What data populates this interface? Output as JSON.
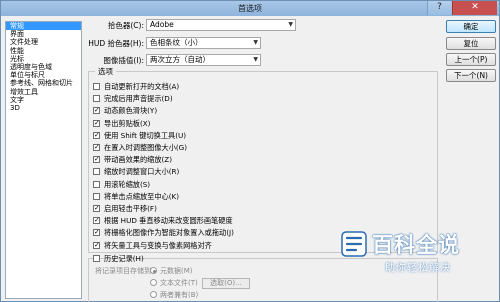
{
  "window": {
    "title": "首选项",
    "help_label": "?",
    "close_label": "✕"
  },
  "sidebar": {
    "items": [
      {
        "label": "常规",
        "selected": true
      },
      {
        "label": "界面"
      },
      {
        "label": "文件处理"
      },
      {
        "label": "性能"
      },
      {
        "label": "光标"
      },
      {
        "label": "透明度与色域"
      },
      {
        "label": "单位与标尺"
      },
      {
        "label": "参考线、网格和切片"
      },
      {
        "label": "增效工具"
      },
      {
        "label": "文字"
      },
      {
        "label": "3D"
      }
    ]
  },
  "settings": {
    "color_picker_label": "拾色器(C):",
    "color_picker_value": "Adobe",
    "hud_picker_label": "HUD 拾色器(H):",
    "hud_picker_value": "色相条纹（小）",
    "interp_label": "图像插值(I):",
    "interp_value": "两次立方（自动）"
  },
  "buttons": {
    "ok": "确定",
    "reset": "复位",
    "prev": "上一个(P)",
    "next": "下一个(N)"
  },
  "options": {
    "title": "选项",
    "items": [
      {
        "label": "自动更新打开的文档(A)",
        "checked": false
      },
      {
        "label": "完成后用声音提示(D)",
        "checked": false
      },
      {
        "label": "动态颜色滑块(Y)",
        "checked": true
      },
      {
        "label": "导出剪贴板(X)",
        "checked": true
      },
      {
        "label": "使用 Shift 键切换工具(U)",
        "checked": true
      },
      {
        "label": "在置入时调整图像大小(G)",
        "checked": true
      },
      {
        "label": "带动画效果的缩放(Z)",
        "checked": true
      },
      {
        "label": "缩放时调整窗口大小(R)",
        "checked": false
      },
      {
        "label": "用滚轮缩放(S)",
        "checked": false
      },
      {
        "label": "将单击点缩放至中心(K)",
        "checked": false
      },
      {
        "label": "启用轻击平移(F)",
        "checked": true
      },
      {
        "label": "根据 HUD 垂直移动来改变圆形画笔硬度",
        "checked": true
      },
      {
        "label": "将栅格化图像作为智能对象置入或拖动(J)",
        "checked": true
      },
      {
        "label": "将矢量工具与变换与像素网格对齐",
        "checked": true
      }
    ]
  },
  "history": {
    "checkbox_label": "历史记录(H)",
    "save_to_label": "将记录项目存储到:",
    "radio_metadata": "元数据(M)",
    "radio_textfile": "文本文件(T)",
    "choose_button": "选取(O)...",
    "radio_both": "两者兼有(B)"
  },
  "watermark": {
    "main": "百科全说",
    "sub": "助你轻松解决"
  }
}
